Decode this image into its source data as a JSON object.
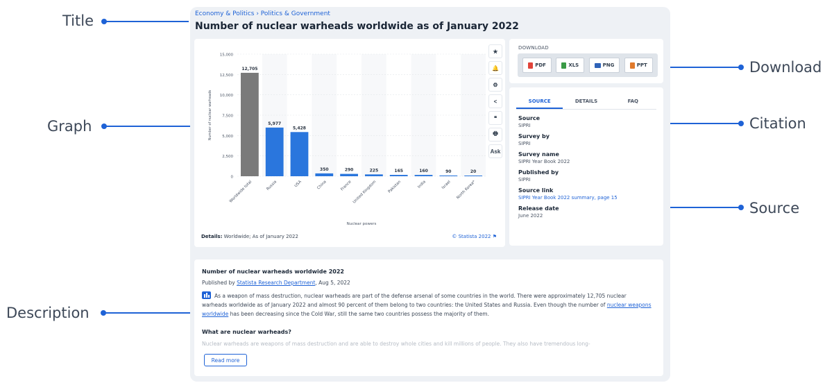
{
  "annotations": {
    "title": "Title",
    "graph": "Graph",
    "description": "Description",
    "download": "Download",
    "citation": "Citation",
    "source": "Source"
  },
  "breadcrumb": "Economy & Politics › Politics & Government",
  "page_title": "Number of nuclear warheads worldwide as of January 2022",
  "sidebar_buttons": [
    "★",
    "🔔",
    "⚙",
    "<",
    "❝",
    "🖶",
    "Ask"
  ],
  "chart_footer": {
    "details_label": "Details:",
    "details_text": "Worldwide; As of January 2022",
    "credit": "© Statista 2022 ⚑"
  },
  "download": {
    "title": "DOWNLOAD",
    "buttons": [
      {
        "label": "PDF",
        "color": "#e0443a"
      },
      {
        "label": "XLS",
        "color": "#3a9a46"
      },
      {
        "label": "PNG",
        "color": "#2f63b8"
      },
      {
        "label": "PPT",
        "color": "#e07a2c"
      }
    ]
  },
  "source_tabs": [
    "SOURCE",
    "DETAILS",
    "FAQ"
  ],
  "source_items": [
    {
      "label": "Source",
      "value": "SIPRI",
      "link": false
    },
    {
      "label": "Survey by",
      "value": "SIPRI",
      "link": false
    },
    {
      "label": "Survey name",
      "value": "SIPRI Year Book 2022",
      "link": false
    },
    {
      "label": "Published by",
      "value": "SIPRI",
      "link": false
    },
    {
      "label": "Source link",
      "value": "SIPRI Year Book 2022 summary, page 15",
      "link": true
    },
    {
      "label": "Release date",
      "value": "June 2022",
      "link": false
    }
  ],
  "description": {
    "title": "Number of nuclear warheads worldwide 2022",
    "published_prefix": "Published by ",
    "publisher": "Statista Research Department",
    "published_date": ", Aug 5, 2022",
    "body_1": "As a weapon of mass destruction, nuclear warheads are part of the defense arsenal of some countries in the world. There were approximately 12,705 nuclear warheads worldwide as of January 2022 and almost 90 percent of them belong to two countries: the United States and Russia. Even though the number of ",
    "body_link": "nuclear weapons worldwide",
    "body_2": " has been decreasing since the Cold War, still the same two countries possess the majority of them.",
    "subheading": "What are nuclear warheads?",
    "faded": "Nuclear warheads are weapons of mass destruction and are able to destroy whole cities and kill millions of people. They also have tremendous long-",
    "read_more": "Read more"
  },
  "chart_data": {
    "type": "bar",
    "categories": [
      "Worldwide total",
      "Russia",
      "USA",
      "China",
      "France",
      "United Kingdom",
      "Pakistan",
      "India",
      "Israel",
      "North Korea*"
    ],
    "values": [
      12705,
      5977,
      5428,
      350,
      290,
      225,
      165,
      160,
      90,
      20
    ],
    "value_labels": [
      "12,705",
      "5,977",
      "5,428",
      "350",
      "290",
      "225",
      "165",
      "160",
      "90",
      "20"
    ],
    "bar_colors": [
      "#7a7a7a",
      "#2a76dd",
      "#2a76dd",
      "#2a76dd",
      "#2a76dd",
      "#2a76dd",
      "#2a76dd",
      "#2a76dd",
      "#2a76dd",
      "#2a76dd"
    ],
    "xlabel": "Nuclear powers",
    "ylabel": "Number of nuclear warheads",
    "ylim": [
      0,
      15000
    ],
    "yticks": [
      0,
      2500,
      5000,
      7500,
      10000,
      12500,
      15000
    ],
    "ytick_labels": [
      "0",
      "2,500",
      "5,000",
      "7,500",
      "10,000",
      "12,500",
      "15,000"
    ],
    "grid": true,
    "legend": "none"
  }
}
